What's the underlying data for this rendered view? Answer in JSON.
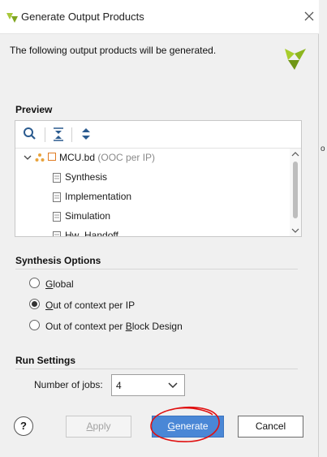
{
  "window": {
    "title": "Generate Output Products"
  },
  "description": "The following output products will be generated.",
  "preview": {
    "title": "Preview",
    "toolbar": [
      "search-icon",
      "collapse-all-icon",
      "expand-all-icon"
    ],
    "root": {
      "label": "MCU.bd",
      "suffix": "(OOC per IP)"
    },
    "items": [
      "Synthesis",
      "Implementation",
      "Simulation",
      "Hw_Handoff"
    ]
  },
  "synthesis_options": {
    "title": "Synthesis Options",
    "options": [
      {
        "pre": "",
        "u": "G",
        "post": "lobal",
        "selected": false
      },
      {
        "pre": "",
        "u": "O",
        "post": "ut of context per IP",
        "selected": true
      },
      {
        "pre": "Out of context per ",
        "u": "B",
        "post": "lock Design",
        "selected": false
      }
    ]
  },
  "run_settings": {
    "title": "Run Settings",
    "jobs_label_pre": "Number of ",
    "jobs_label_u": "j",
    "jobs_label_post": "obs:",
    "jobs_value": "4"
  },
  "buttons": {
    "help": "?",
    "apply": {
      "u": "A",
      "post": "pply"
    },
    "generate": {
      "u": "G",
      "post": "enerate"
    },
    "cancel": "Cancel"
  },
  "colors": {
    "accent": "#4a87d6",
    "brand": "#9dc41f",
    "annotation": "#e01010"
  }
}
